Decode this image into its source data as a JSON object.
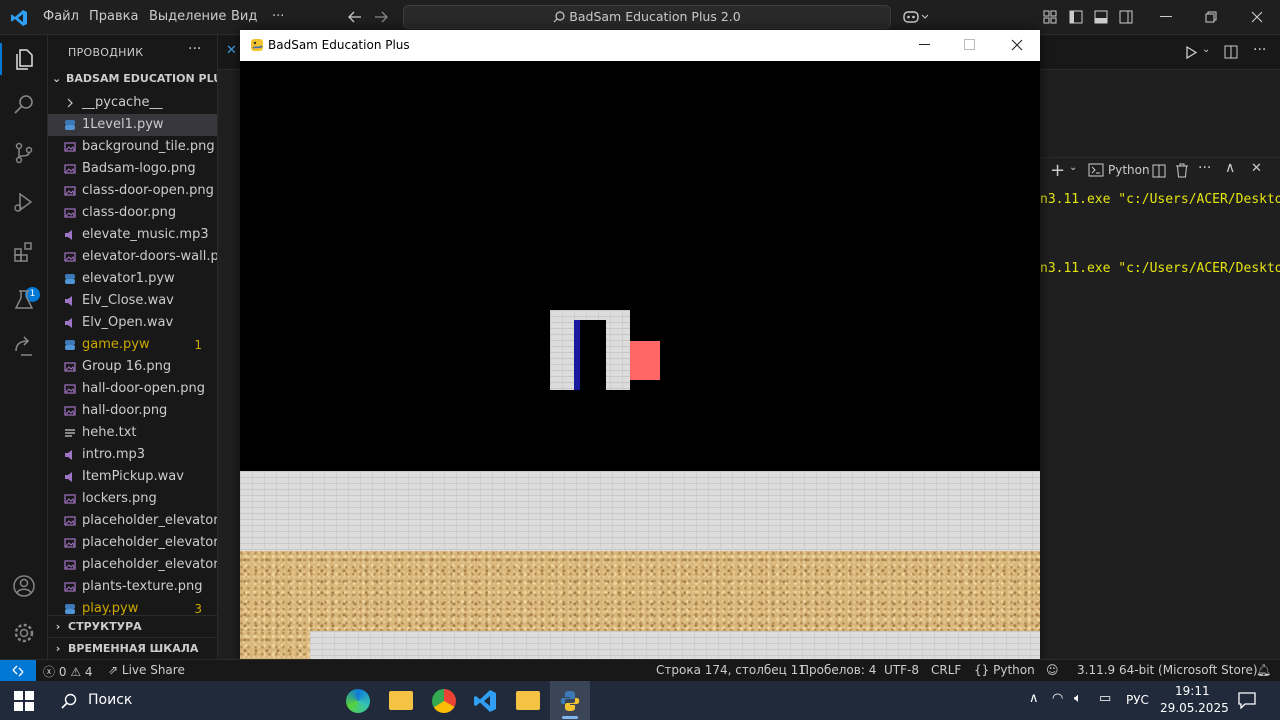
{
  "titlebar": {
    "menus": [
      "Файл",
      "Правка",
      "Выделение",
      "Вид",
      "···"
    ],
    "search_text": "BadSam Education Plus 2.0"
  },
  "sidebar": {
    "header": "ПРОВОДНИК",
    "root": "BADSAM EDUCATION PLU...",
    "files": [
      {
        "name": "__pycache__",
        "kind": "folder"
      },
      {
        "name": "1Level1.pyw",
        "kind": "python",
        "selected": true
      },
      {
        "name": "background_tile.png",
        "kind": "image"
      },
      {
        "name": "Badsam-logo.png",
        "kind": "image"
      },
      {
        "name": "class-door-open.png",
        "kind": "image"
      },
      {
        "name": "class-door.png",
        "kind": "image"
      },
      {
        "name": "elevate_music.mp3",
        "kind": "audio"
      },
      {
        "name": "elevator-doors-wall.p...",
        "kind": "image"
      },
      {
        "name": "elevator1.pyw",
        "kind": "python"
      },
      {
        "name": "Elv_Close.wav",
        "kind": "audio"
      },
      {
        "name": "Elv_Open.wav",
        "kind": "audio"
      },
      {
        "name": "game.pyw",
        "kind": "python",
        "badge": "1",
        "warn": true
      },
      {
        "name": "Group 16.png",
        "kind": "image"
      },
      {
        "name": "hall-door-open.png",
        "kind": "image"
      },
      {
        "name": "hall-door.png",
        "kind": "image"
      },
      {
        "name": "hehe.txt",
        "kind": "text"
      },
      {
        "name": "intro.mp3",
        "kind": "audio"
      },
      {
        "name": "ItemPickup.wav",
        "kind": "audio"
      },
      {
        "name": "lockers.png",
        "kind": "image"
      },
      {
        "name": "placeholder_elevator_...",
        "kind": "image"
      },
      {
        "name": "placeholder_elevator_...",
        "kind": "image"
      },
      {
        "name": "placeholder_elevator...",
        "kind": "image"
      },
      {
        "name": "plants-texture.png",
        "kind": "image"
      },
      {
        "name": "play.pyw",
        "kind": "python",
        "badge": "3",
        "warn": true
      }
    ],
    "sections": [
      "СТРУКТУРА",
      "ВРЕМЕННАЯ ШКАЛА"
    ],
    "extensions_badge": "1"
  },
  "panel": {
    "terminal_label": "Python",
    "lines": [
      "n3.11.exe \"c:/Users/ACER/Deskto",
      "n3.11.exe \"c:/Users/ACER/Deskto"
    ]
  },
  "game_window": {
    "title": "BadSam Education Plus"
  },
  "statusbar": {
    "errors": "0",
    "warnings": "4",
    "live_share": "Live Share",
    "position": "Строка 174, столбец 11",
    "spaces": "Пробелов: 4",
    "encoding": "UTF-8",
    "eol": "CRLF",
    "language": "Python",
    "interpreter": "3.11.9 64-bit (Microsoft Store)"
  },
  "taskbar": {
    "search_placeholder": "Поиск",
    "lang": "РУС",
    "time": "19:11",
    "date": "29.05.2025"
  },
  "colors": {
    "accent": "#0078d4",
    "player": "#ff6666",
    "door": "#1a1aa0"
  }
}
